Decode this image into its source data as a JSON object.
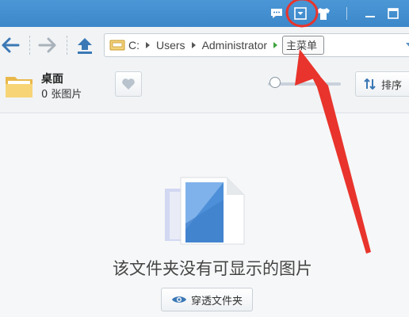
{
  "titlebar": {
    "icons": [
      "chat-icon",
      "dropdown-menu-icon",
      "skin-icon",
      "minimize-icon",
      "maximize-icon"
    ]
  },
  "nav": {
    "icons": [
      "back-arrow-icon",
      "forward-arrow-icon",
      "up-arrow-icon"
    ]
  },
  "address": {
    "drive": "C:",
    "crumbs": [
      "Users",
      "Administrator"
    ],
    "current": "主菜单"
  },
  "folder": {
    "title": "桌面",
    "count": "0 张图片"
  },
  "toolbar": {
    "favorite_icon": "heart-icon",
    "zoom_level": 0,
    "sort_label": "排序"
  },
  "empty": {
    "message": "该文件夹没有可显示的图片",
    "button_label": "穿透文件夹"
  },
  "colors": {
    "titlebar": "#3b87c9",
    "annotation": "#e8342c",
    "nav_icon": "#3b78b5"
  }
}
